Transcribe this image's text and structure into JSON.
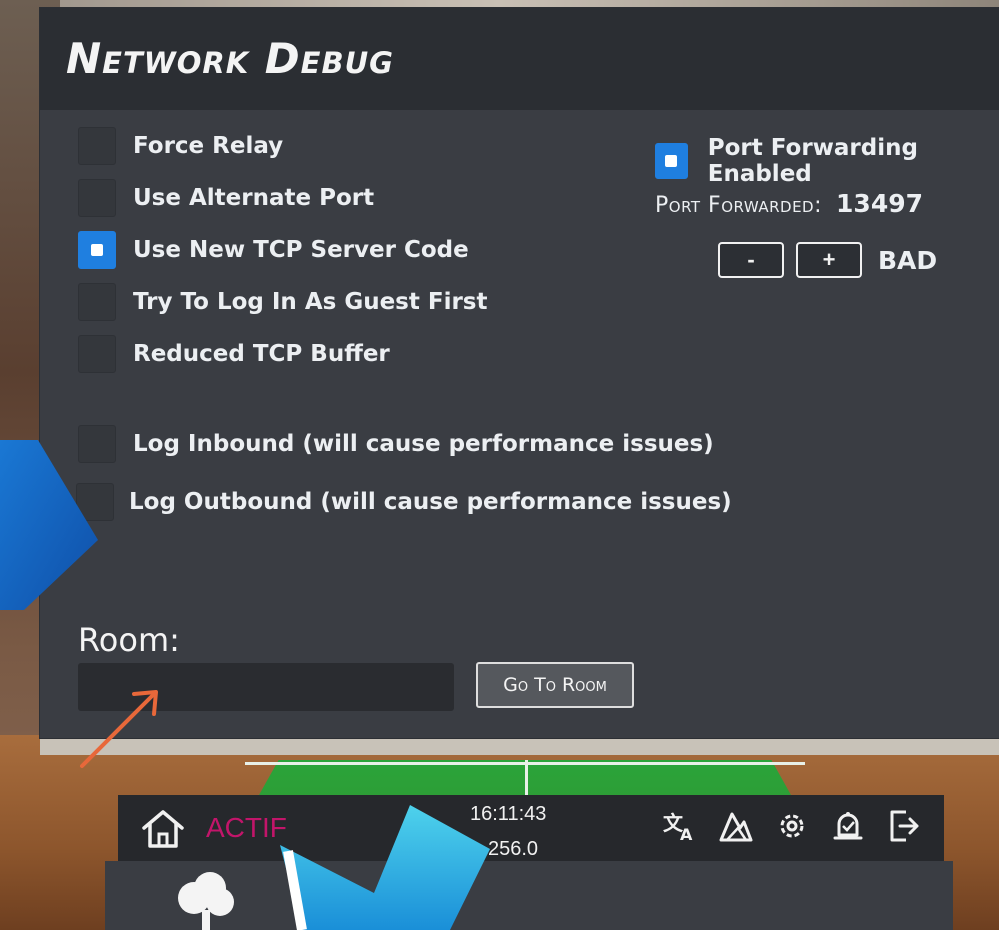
{
  "panel": {
    "title": "Network Debug",
    "checkboxes": [
      {
        "label": "Force Relay",
        "checked": false
      },
      {
        "label": "Use Alternate Port",
        "checked": false
      },
      {
        "label": "Use New TCP Server Code",
        "checked": true
      },
      {
        "label": "Try To Log In As Guest First",
        "checked": false
      },
      {
        "label": "Reduced TCP Buffer",
        "checked": false
      },
      {
        "label": "Log Inbound (will cause performance issues)",
        "checked": false
      },
      {
        "label": "Log Outbound  (will cause performance issues)",
        "checked": false
      }
    ],
    "port_forwarding": {
      "label": "Port Forwarding Enabled",
      "checked": true
    },
    "port_forwarded_label": "Port Forwarded:",
    "port_forwarded_value": "13497",
    "decrement_label": "-",
    "increment_label": "+",
    "status": "BAD",
    "room_label": "Room:",
    "room_input_value": "",
    "goto_button": "Go To Room"
  },
  "bottom_bar": {
    "status": "ACTIF",
    "time": "16:11:43",
    "sub_value": "256.0",
    "status_color": "#c2156a",
    "icons": [
      "translate-icon",
      "terrain-icon",
      "settings-icon",
      "notification-bell-icon",
      "logout-icon"
    ]
  },
  "colors": {
    "panel_bg": "#3a3d43",
    "header_bg": "#2b2e33",
    "checkbox_checked": "#1f7fe0"
  }
}
